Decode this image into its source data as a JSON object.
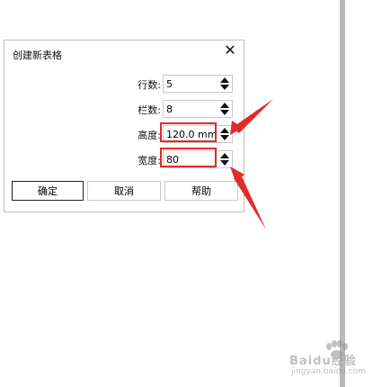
{
  "dialog": {
    "title": "创建新表格",
    "close_glyph": "✕",
    "fields": [
      {
        "label": "行数:",
        "value": "5"
      },
      {
        "label": "栏数:",
        "value": "8"
      },
      {
        "label": "高度:",
        "value": "120.0 mm"
      },
      {
        "label": "宽度:",
        "value": "80"
      }
    ],
    "buttons": {
      "ok": "确定",
      "cancel": "取消",
      "help": "帮助"
    }
  },
  "watermark": {
    "brand": "Baidu经验",
    "url": "jingyan.baidu.com"
  },
  "colors": {
    "annotation": "#e12a2a"
  }
}
